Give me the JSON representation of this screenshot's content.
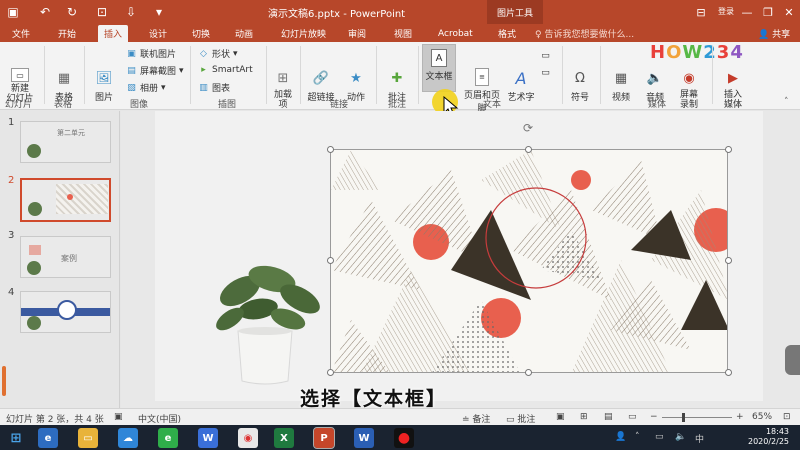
{
  "titlebar": {
    "title": "演示文稿6.pptx - PowerPoint",
    "context_tab": "图片工具",
    "signin": "登录"
  },
  "tabs": [
    "文件",
    "开始",
    "插入",
    "设计",
    "切换",
    "动画",
    "幻灯片放映",
    "审阅",
    "视图",
    "Acrobat",
    "格式"
  ],
  "active_tab": "插入",
  "tell_me": "告诉我您想要做什么...",
  "share": "共享",
  "logo": "HOW234",
  "ribbon": {
    "new_slide": "新建\n幻灯片",
    "table": "表格",
    "pictures": "图片",
    "online_pictures": "联机图片",
    "screenshot": "屏幕截图",
    "album": "相册",
    "shapes": "形状",
    "smartart": "SmartArt",
    "chart": "图表",
    "addins": "加载\n项",
    "hyperlink": "超链接",
    "action": "动作",
    "comment": "批注",
    "textbox": "文本框",
    "header_footer": "页眉和页脚",
    "wordart": "艺术字",
    "symbol": "符号",
    "video": "视频",
    "audio": "音频",
    "screen_record": "屏幕\n录制",
    "insert_media": "插入\n媒体",
    "groups": {
      "slides": "幻灯片",
      "tables": "表格",
      "images": "图像",
      "illustrations": "插图",
      "links": "链接",
      "comments": "批注",
      "text": "文本",
      "media": "媒体",
      "media2": "媒体"
    }
  },
  "slides": [
    {
      "num": "1",
      "label": "第二单元"
    },
    {
      "num": "2",
      "label": ""
    },
    {
      "num": "3",
      "label": "案例"
    },
    {
      "num": "4",
      "label": ""
    }
  ],
  "status": {
    "slide_info": "幻灯片 第 2 张，共 4 张",
    "language": "中文(中国)",
    "notes": "备注",
    "comments": "批注",
    "zoom": "65%"
  },
  "subtitle": "选择【文本框】",
  "clock": {
    "time": "18:43",
    "date": "2020/2/25"
  },
  "colors": {
    "accent": "#b7472a",
    "taskbar": "#1a2330"
  }
}
